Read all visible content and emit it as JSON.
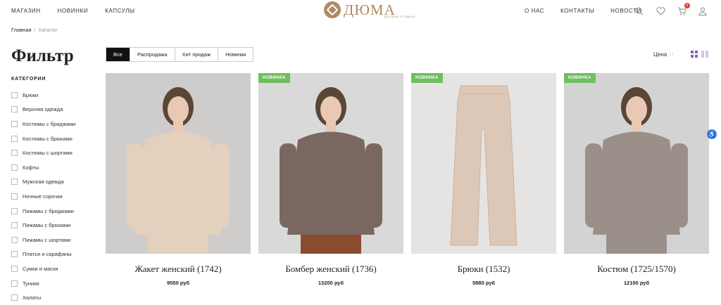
{
  "header": {
    "left_nav": [
      "МАГАЗИН",
      "НОВИНКИ",
      "КАПСУЛЫ"
    ],
    "right_nav": [
      "О НАС",
      "КОНТАКТЫ",
      "НОВОСТИ"
    ],
    "logo_title": "ДЮМА",
    "logo_subtitle": "ДЛЯ ДОМА И ОТДЫХА",
    "cart_count": "0",
    "brand_color": "#b08a63"
  },
  "breadcrumb": {
    "home": "Главная",
    "separator": "/",
    "current": "Каталог"
  },
  "filter": {
    "title": "Фильтр",
    "categories_heading": "КАТЕГОРИИ",
    "categories": [
      "Брюки",
      "Верхняя одежда",
      "Костюмы с бриджами",
      "Костюмы с брюками",
      "Костюмы с шортами",
      "Кофты",
      "Мужская одежда",
      "Ночные сорочки",
      "Пижамы с бриджами",
      "Пижамы с брюками",
      "Пижамы с шортами",
      "Платья и сарафаны",
      "Сумки и маски",
      "Туники",
      "Халаты"
    ]
  },
  "tabs": [
    {
      "label": "Все",
      "active": true
    },
    {
      "label": "Распродажа",
      "active": false
    },
    {
      "label": "Хит продаж",
      "active": false
    },
    {
      "label": "Новинки",
      "active": false
    }
  ],
  "sort": {
    "label": "Цена",
    "arrows": "↓↑"
  },
  "products": [
    {
      "name": "Жакет женский (1742)",
      "price": "9550 руб",
      "badge": "",
      "bg": "#cfcdcb",
      "garment": "#e3d0bd"
    },
    {
      "name": "Бомбер женский (1736)",
      "price": "13200 руб",
      "badge": "НОВИНКА",
      "bg": "#d9d9d9",
      "garment": "#7a6860"
    },
    {
      "name": "Брюки (1532)",
      "price": "5880 руб",
      "badge": "НОВИНКА",
      "bg": "#e6e4e2",
      "garment": "#ddc8b8"
    },
    {
      "name": "Костюм (1725/1570)",
      "price": "12100 руб",
      "badge": "НОВИНКА",
      "bg": "#d4d3d3",
      "garment": "#9a9089"
    }
  ]
}
